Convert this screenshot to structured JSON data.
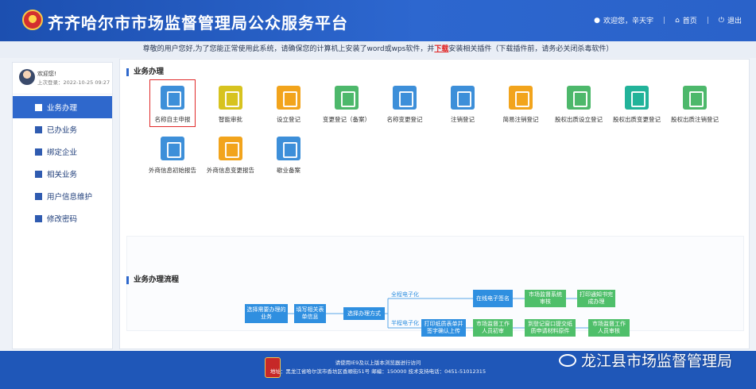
{
  "header": {
    "title": "齐齐哈尔市市场监督管理局公众服务平台",
    "user_greeting": "欢迎您，辛天宇",
    "home": "首页",
    "logout": "退出"
  },
  "notice": {
    "prefix": "尊敬的用户您好,为了您能正常使用此系统，请确保您的计算机上安装了word或wps软件，并",
    "download": "下载",
    "suffix": "安装相关插件（下载插件前，请务必关闭杀毒软件）"
  },
  "sidebar": {
    "welcome": "欢迎您!",
    "last_login": "上次登录：2022-10-25 09:27",
    "items": [
      {
        "label": "业务办理",
        "active": true
      },
      {
        "label": "已办业务"
      },
      {
        "label": "绑定企业"
      },
      {
        "label": "相关业务"
      },
      {
        "label": "用户信息维护"
      },
      {
        "label": "修改密码"
      }
    ]
  },
  "main": {
    "section1": "业务办理",
    "section2": "业务办理流程",
    "services": [
      {
        "label": "名称自主申报",
        "color": "#3d8fd9"
      },
      {
        "label": "智能审批",
        "color": "#d7c31f"
      },
      {
        "label": "设立登记",
        "color": "#f2a41c"
      },
      {
        "label": "变更登记（备案）",
        "color": "#4db86b"
      },
      {
        "label": "名称变更登记",
        "color": "#3d8fd9"
      },
      {
        "label": "注销登记",
        "color": "#3d8fd9"
      },
      {
        "label": "简易注销登记",
        "color": "#f2a41c"
      },
      {
        "label": "股权出质设立登记",
        "color": "#4db86b"
      },
      {
        "label": "股权出质变更登记",
        "color": "#22b39a"
      },
      {
        "label": "股权出质注销登记",
        "color": "#4db86b"
      },
      {
        "label": "外商信息初始报告",
        "color": "#3d8fd9"
      },
      {
        "label": "外商信息变更报告",
        "color": "#f2a41c"
      },
      {
        "label": "歇业备案",
        "color": "#3d8fd9"
      }
    ],
    "flow": {
      "start": "选择需要办理的业务",
      "step2": "填写相关表单信息",
      "step3": "选择办理方式",
      "tag_full": "全程电子化",
      "tag_half": "半程电子化",
      "full1": "在线电子签名",
      "full2": "市场监督系统审核",
      "full3": "打印通知书完成办理",
      "half1": "打印纸质表单并签字确认上传",
      "half2": "市场监督工作人员初审",
      "half3": "到登记窗口提交纸质申请材料原件",
      "half4": "市场监督工作人员审核"
    }
  },
  "footer": {
    "line1": "请使用IE9及以上版本浏览器进行访问",
    "line2": "地址：黑龙江省哈尔滨市香坊区香顺街51号 邮编：150000 技术支持电话：0451-51012315",
    "watermark": "龙江县市场监督管理局"
  }
}
